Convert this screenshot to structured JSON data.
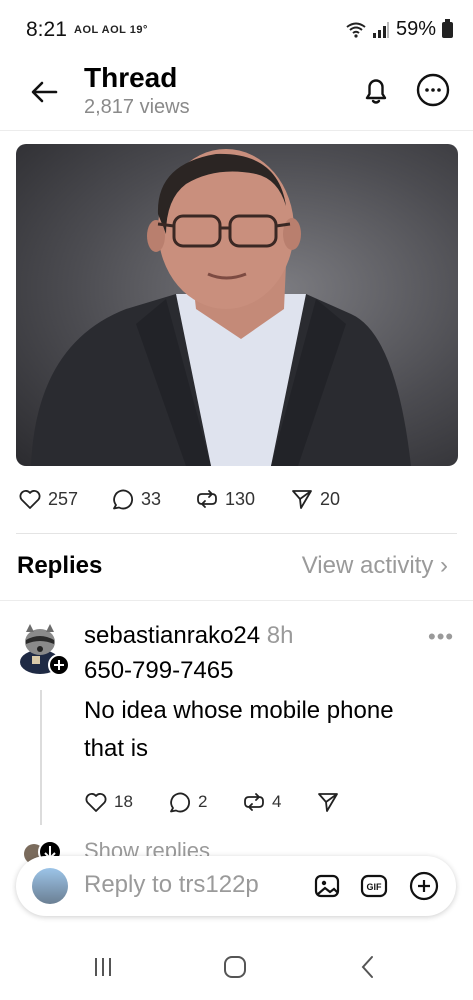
{
  "status_bar": {
    "time": "8:21",
    "carriers": "AOL AOL 19°",
    "battery": "59%"
  },
  "header": {
    "title": "Thread",
    "views": "2,817 views"
  },
  "post_stats": {
    "likes": "257",
    "comments": "33",
    "reposts": "130",
    "shares": "20"
  },
  "replies_section": {
    "label": "Replies",
    "view_activity": "View activity"
  },
  "reply": {
    "username": "sebastianrako24",
    "time_ago": "8h",
    "line1": "650-799-7465",
    "line2": "No idea whose mobile phone",
    "line3": "that is",
    "likes": "18",
    "comments": "2",
    "reposts": "4"
  },
  "show_replies": "Show replies",
  "reply_bar": {
    "placeholder": "Reply to trs122p"
  },
  "colors": {
    "text_secondary": "#9a9a9a",
    "divider": "#e4e4e4"
  }
}
